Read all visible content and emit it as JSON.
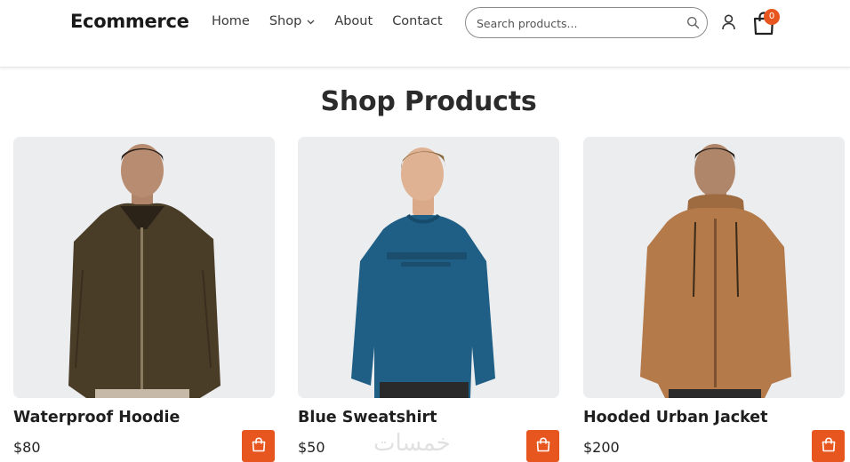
{
  "brand": {
    "logo": "Ecommerce",
    "accent": "#e8561f"
  },
  "nav": {
    "items": [
      {
        "label": "Home"
      },
      {
        "label": "Shop",
        "has_dropdown": true
      },
      {
        "label": "About"
      },
      {
        "label": "Contact"
      }
    ]
  },
  "search": {
    "placeholder": "Search products...",
    "value": ""
  },
  "cart": {
    "count": "0"
  },
  "page": {
    "title": "Shop Products"
  },
  "products": [
    {
      "name": "Waterproof Hoodie",
      "price": "$80",
      "jacket_color": "#4a3d28"
    },
    {
      "name": "Blue Sweatshirt",
      "price": "$50",
      "jacket_color": "#1f5f86"
    },
    {
      "name": "Hooded Urban Jacket",
      "price": "$200",
      "jacket_color": "#b47a4a"
    }
  ],
  "icons": {
    "search": "search-icon",
    "user": "user-icon",
    "cart": "shopping-bag-icon",
    "add_to_cart": "shopping-bag-icon",
    "dropdown": "chevron-down-icon"
  },
  "watermark": "خمسات"
}
